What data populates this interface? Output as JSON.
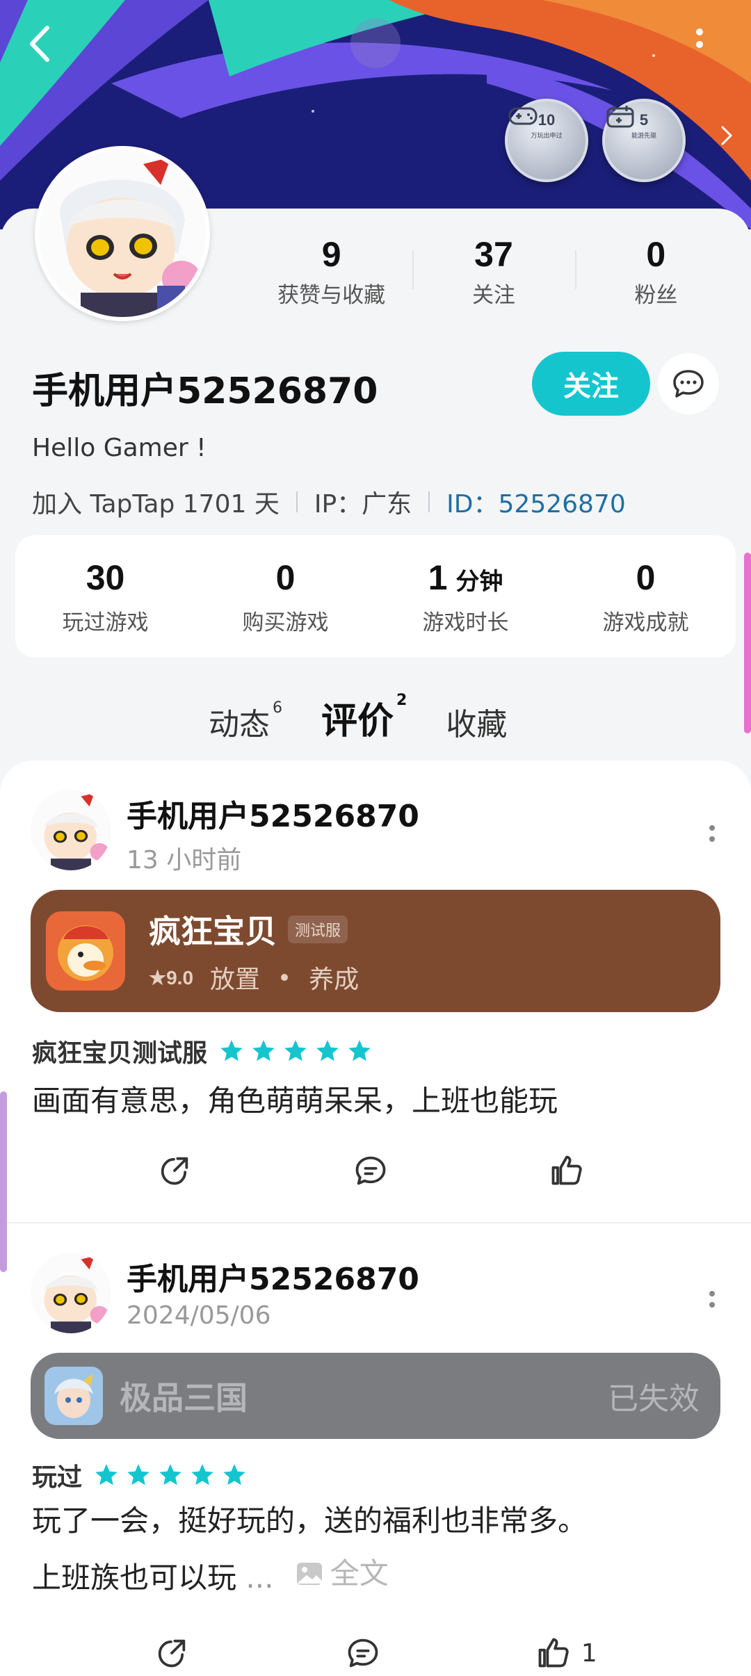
{
  "header": {
    "badges": [
      {
        "num": "10",
        "sub": "万玩出申过"
      },
      {
        "num": "5",
        "sub": "能游先驱"
      }
    ]
  },
  "profile": {
    "stats": [
      {
        "value": "9",
        "label": "获赞与收藏"
      },
      {
        "value": "37",
        "label": "关注"
      },
      {
        "value": "0",
        "label": "粉丝"
      }
    ],
    "username": "手机用户52526870",
    "follow_label": "关注",
    "bio": "Hello Gamer !",
    "joined": "加入 TapTap 1701 天",
    "ip": "IP：广东",
    "id": "ID：52526870"
  },
  "game_stats": [
    {
      "value": "30",
      "unit": "",
      "label": "玩过游戏"
    },
    {
      "value": "0",
      "unit": "",
      "label": "购买游戏"
    },
    {
      "value": "1",
      "unit": "分钟",
      "label": "游戏时长"
    },
    {
      "value": "0",
      "unit": "",
      "label": "游戏成就"
    }
  ],
  "tabs": [
    {
      "label": "动态",
      "count": "6"
    },
    {
      "label": "评价",
      "count": "2"
    },
    {
      "label": "收藏",
      "count": ""
    }
  ],
  "posts": [
    {
      "username": "手机用户52526870",
      "time": "13 小时前",
      "game": {
        "title": "疯狂宝贝",
        "tag": "测试服",
        "score": "9.0",
        "genre1": "放置",
        "genre2": "养成"
      },
      "rating_label": "疯狂宝贝测试服",
      "stars": 5,
      "review": "画面有意思，角色萌萌呆呆，上班也能玩",
      "like_count": ""
    },
    {
      "username": "手机用户52526870",
      "time": "2024/05/06",
      "game": {
        "title": "极品三国",
        "status": "已失效"
      },
      "rating_label": "玩过",
      "stars": 5,
      "review_line1": "玩了一会，挺好玩的，送的福利也非常多。",
      "review_line2": "上班族也可以玩",
      "ellipsis": "...",
      "fulltext": "全文",
      "like_count": "1"
    }
  ],
  "colors": {
    "accent": "#15c5ce",
    "star": "#15c5ce",
    "brown_card": "#7d4a30",
    "gray_card": "#7b7c80",
    "id_link": "#1d6fa5"
  }
}
